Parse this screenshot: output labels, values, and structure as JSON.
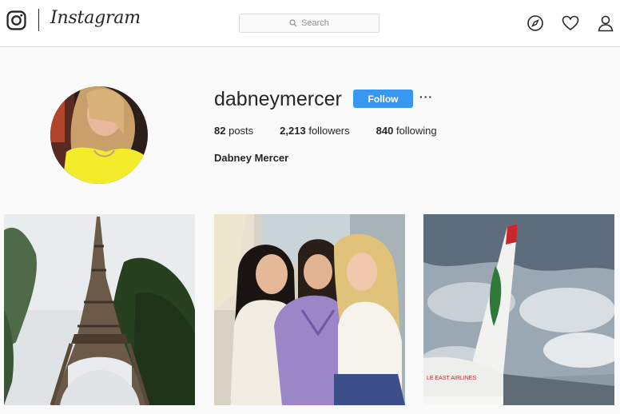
{
  "header": {
    "logo_icon": "instagram-camera-icon",
    "wordmark": "Instagram",
    "search_placeholder": "Search",
    "nav_icons": [
      "compass-icon",
      "heart-icon",
      "person-icon"
    ]
  },
  "profile": {
    "username": "dabneymercer",
    "follow_label": "Follow",
    "more_label": "···",
    "posts_count": "82",
    "posts_label": "posts",
    "followers_count": "2,213",
    "followers_label": "followers",
    "following_count": "840",
    "following_label": "following",
    "full_name": "Dabney Mercer"
  },
  "posts": [
    {
      "subject": "eiffel-tower"
    },
    {
      "subject": "three-women"
    },
    {
      "subject": "airplane-tail-middle-east-airlines",
      "visible_text": "LE EAST AIRLINES"
    }
  ],
  "colors": {
    "accent": "#3897f0",
    "border": "#dbdbdb",
    "background": "#fafafa"
  }
}
